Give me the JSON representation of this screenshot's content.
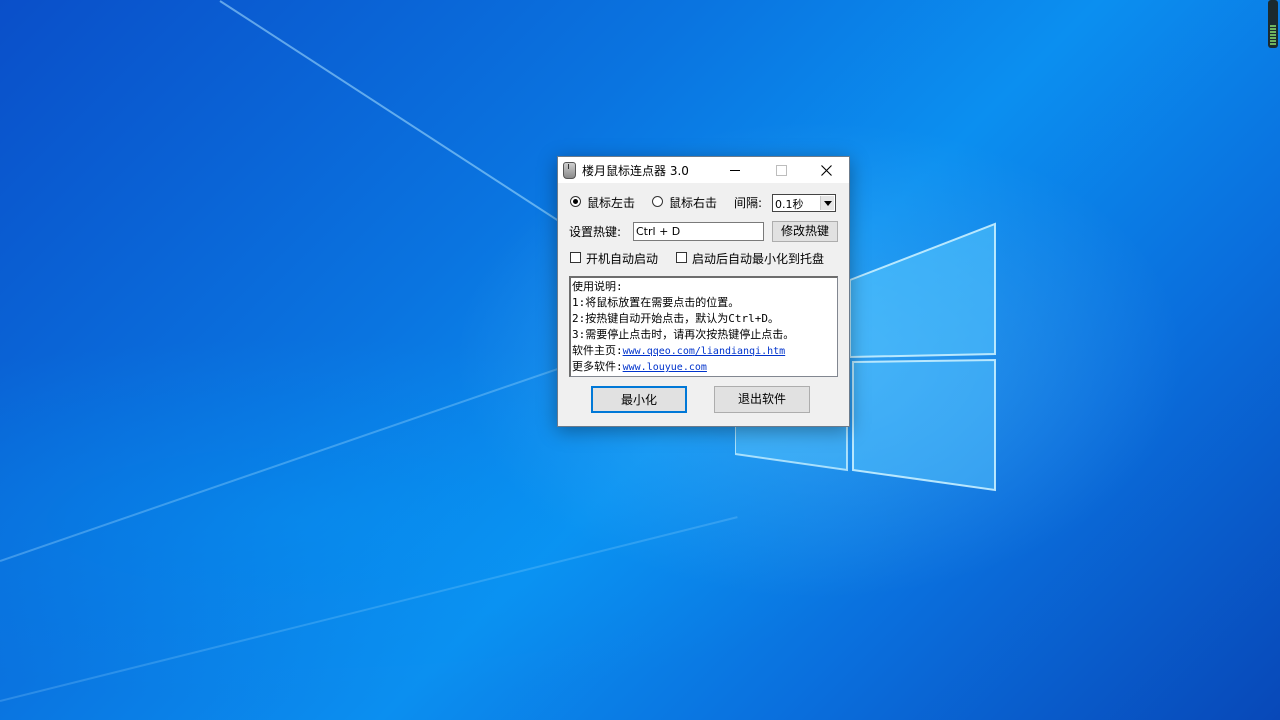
{
  "window": {
    "title": "楼月鼠标连点器 3.0",
    "radio_left_label": "鼠标左击",
    "radio_right_label": "鼠标右击",
    "interval_label": "间隔:",
    "interval_value": "0.1秒",
    "hotkey_label": "设置热键:",
    "hotkey_value": "Ctrl + D",
    "change_hotkey_button": "修改热键",
    "autostart_label": "开机自动启动",
    "minimize_tray_label": "启动后自动最小化到托盘",
    "minimize_button": "最小化",
    "exit_button": "退出软件"
  },
  "instructions": {
    "line1": "使用说明:",
    "line2": "1:将鼠标放置在需要点击的位置。",
    "line3": "2:按热键自动开始点击，默认为Ctrl+D。",
    "line4": "3:需要停止点击时，请再次按热键停止点击。",
    "homepage_label": "软件主页:",
    "homepage_link": "www.qqeo.com/liandianqi.htm",
    "more_label": "更多软件:",
    "more_link": "www.louyue.com"
  },
  "state": {
    "selected_click": "left",
    "autostart_checked": false,
    "minimize_tray_checked": false
  },
  "icons": [
    "app-mouse-icon",
    "minimize-icon",
    "maximize-icon",
    "close-icon",
    "dropdown-arrow-icon"
  ]
}
